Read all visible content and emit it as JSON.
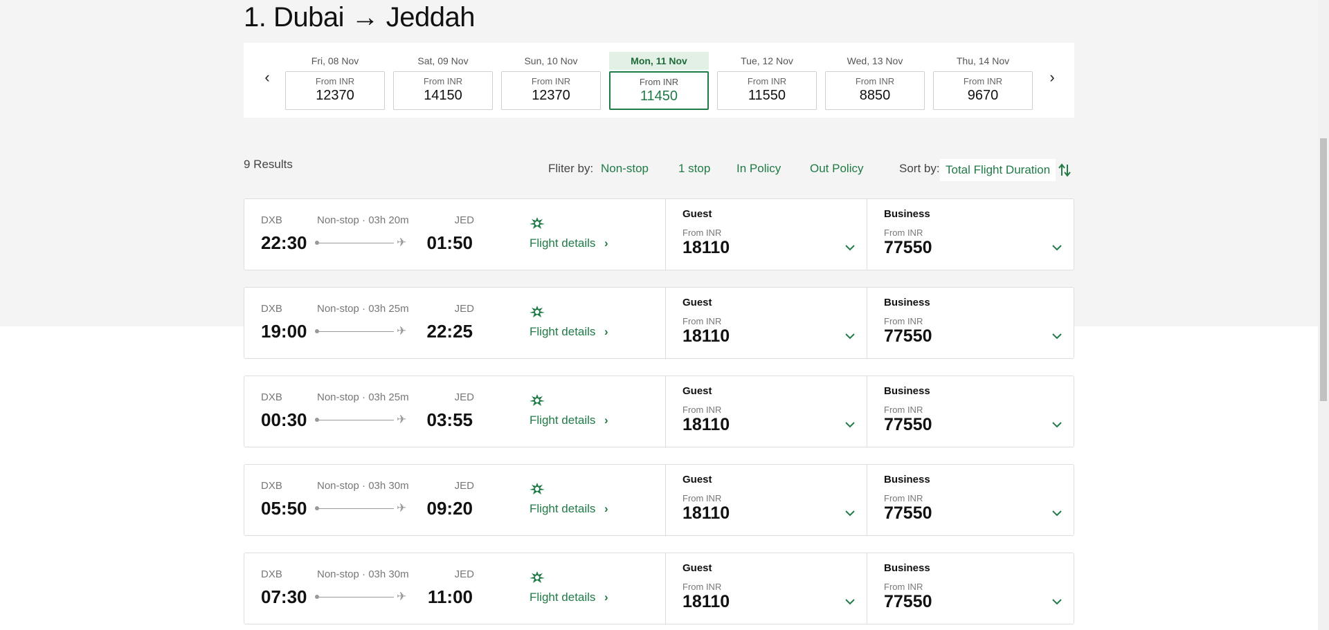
{
  "page": {
    "title": "1. Dubai → Jeddah"
  },
  "date_strip": {
    "prev_icon": "chevron-left-icon",
    "next_icon": "chevron-right-icon",
    "days": [
      {
        "label": "Fri, 08 Nov",
        "from": "From INR",
        "price": "12370",
        "selected": false
      },
      {
        "label": "Sat, 09 Nov",
        "from": "From INR",
        "price": "14150",
        "selected": false
      },
      {
        "label": "Sun, 10 Nov",
        "from": "From INR",
        "price": "12370",
        "selected": false
      },
      {
        "label": "Mon, 11 Nov",
        "from": "From INR",
        "price": "11450",
        "selected": true
      },
      {
        "label": "Tue, 12 Nov",
        "from": "From INR",
        "price": "11550",
        "selected": false
      },
      {
        "label": "Wed, 13 Nov",
        "from": "From INR",
        "price": "8850",
        "selected": false
      },
      {
        "label": "Thu, 14 Nov",
        "from": "From INR",
        "price": "9670",
        "selected": false
      }
    ]
  },
  "results": {
    "count": "9 Results",
    "filter_label": "Fliter by:",
    "filters": [
      "Non-stop",
      "1 stop",
      "In Policy",
      "Out Policy"
    ],
    "sort_label": "Sort by:",
    "sort_value": "Total Flight Duration",
    "sort_icon": "sort-arrows-icon"
  },
  "flights": [
    {
      "origin": "DXB",
      "stops": "Non-stop · 03h 20m",
      "dest": "JED",
      "dep": "22:30",
      "arr": "01:50",
      "details": "Flight details",
      "guest_name": "Guest",
      "guest_from": "From INR",
      "guest_price": "18110",
      "business_name": "Business",
      "business_from": "From INR",
      "business_price": "77550"
    },
    {
      "origin": "DXB",
      "stops": "Non-stop · 03h 25m",
      "dest": "JED",
      "dep": "19:00",
      "arr": "22:25",
      "details": "Flight details",
      "guest_name": "Guest",
      "guest_from": "From INR",
      "guest_price": "18110",
      "business_name": "Business",
      "business_from": "From INR",
      "business_price": "77550"
    },
    {
      "origin": "DXB",
      "stops": "Non-stop · 03h 25m",
      "dest": "JED",
      "dep": "00:30",
      "arr": "03:55",
      "details": "Flight details",
      "guest_name": "Guest",
      "guest_from": "From INR",
      "guest_price": "18110",
      "business_name": "Business",
      "business_from": "From INR",
      "business_price": "77550"
    },
    {
      "origin": "DXB",
      "stops": "Non-stop · 03h 30m",
      "dest": "JED",
      "dep": "05:50",
      "arr": "09:20",
      "details": "Flight details",
      "guest_name": "Guest",
      "guest_from": "From INR",
      "guest_price": "18110",
      "business_name": "Business",
      "business_from": "From INR",
      "business_price": "77550"
    },
    {
      "origin": "DXB",
      "stops": "Non-stop · 03h 30m",
      "dest": "JED",
      "dep": "07:30",
      "arr": "11:00",
      "details": "Flight details",
      "guest_name": "Guest",
      "guest_from": "From INR",
      "guest_price": "18110",
      "business_name": "Business",
      "business_from": "From INR",
      "business_price": "77550"
    }
  ],
  "colors": {
    "accent": "#1f7a45",
    "selected_bg": "#e2f0e6",
    "page_bg": "#f4f4f4"
  },
  "icons": {
    "airline": "airline-logo-icon",
    "plane": "plane-icon",
    "fare_expand": "chevron-down-icon",
    "details_arrow": "chevron-right-icon"
  }
}
